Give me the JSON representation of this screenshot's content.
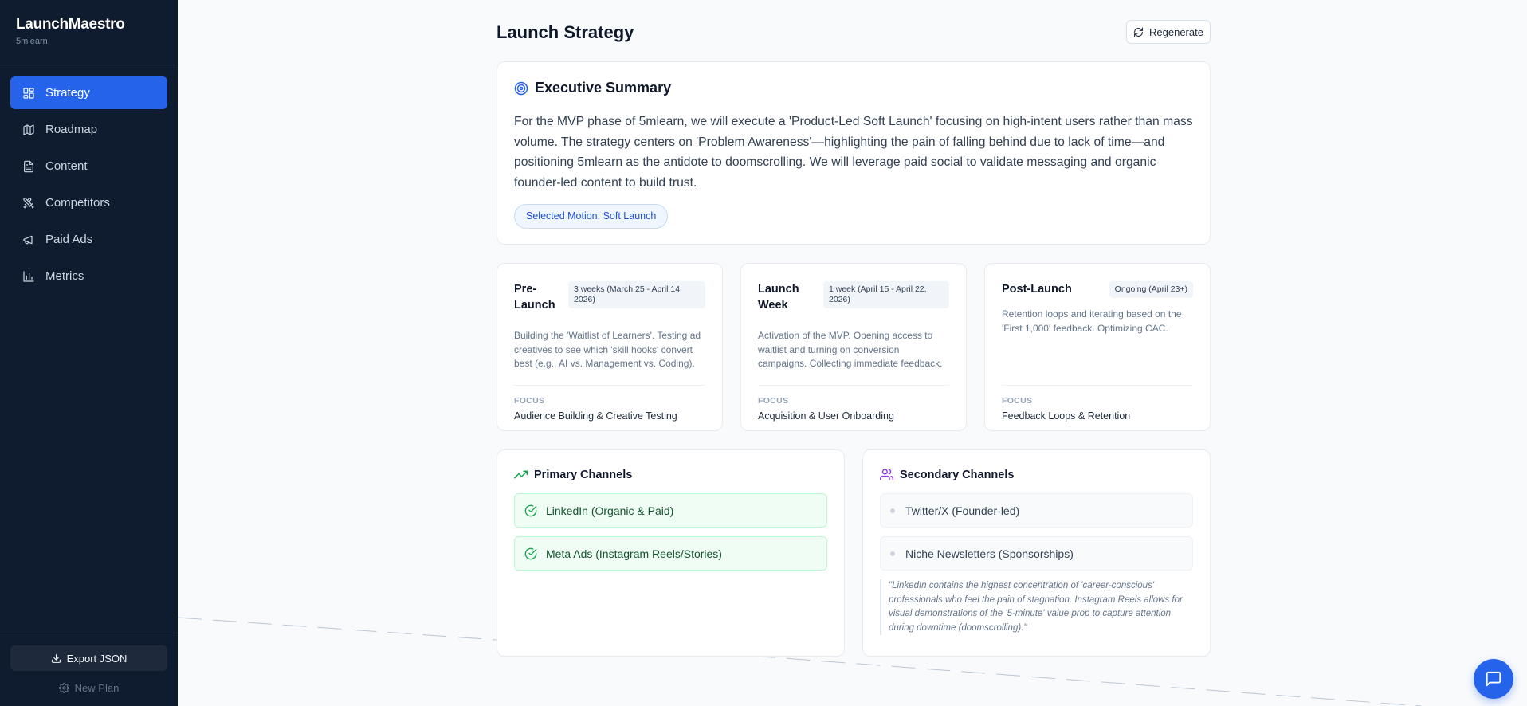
{
  "app": {
    "name": "LaunchMaestro",
    "project": "5mlearn"
  },
  "sidebar": {
    "items": [
      {
        "label": "Strategy",
        "icon": "grid-icon",
        "active": true
      },
      {
        "label": "Roadmap",
        "icon": "map-icon",
        "active": false
      },
      {
        "label": "Content",
        "icon": "file-text-icon",
        "active": false
      },
      {
        "label": "Competitors",
        "icon": "swords-icon",
        "active": false
      },
      {
        "label": "Paid Ads",
        "icon": "megaphone-icon",
        "active": false
      },
      {
        "label": "Metrics",
        "icon": "bar-chart-icon",
        "active": false
      }
    ],
    "export_label": "Export JSON",
    "new_plan_label": "New Plan"
  },
  "header": {
    "title": "Launch Strategy",
    "regenerate_label": "Regenerate"
  },
  "summary": {
    "title": "Executive Summary",
    "body": "For the MVP phase of 5mlearn, we will execute a 'Product-Led Soft Launch' focusing on high-intent users rather than mass volume. The strategy centers on 'Problem Awareness'—highlighting the pain of falling behind due to lack of time—and positioning 5mlearn as the antidote to doomscrolling. We will leverage paid social to validate messaging and organic founder-led content to build trust.",
    "motion_badge": "Selected Motion: Soft Launch"
  },
  "phases": [
    {
      "name": "Pre-Launch",
      "duration": "3 weeks (March 25 - April 14, 2026)",
      "description": "Building the 'Waitlist of Learners'. Testing ad creatives to see which 'skill hooks' convert best (e.g., AI vs. Management vs. Coding).",
      "focus_label": "FOCUS",
      "focus": "Audience Building & Creative Testing"
    },
    {
      "name": "Launch Week",
      "duration": "1 week (April 15 - April 22, 2026)",
      "description": "Activation of the MVP. Opening access to waitlist and turning on conversion campaigns. Collecting immediate feedback.",
      "focus_label": "FOCUS",
      "focus": "Acquisition & User Onboarding"
    },
    {
      "name": "Post-Launch",
      "duration": "Ongoing (April 23+)",
      "description": "Retention loops and iterating based on the 'First 1,000' feedback. Optimizing CAC.",
      "focus_label": "FOCUS",
      "focus": "Feedback Loops & Retention"
    }
  ],
  "primary_channels": {
    "title": "Primary Channels",
    "items": [
      "LinkedIn (Organic & Paid)",
      "Meta Ads (Instagram Reels/Stories)"
    ]
  },
  "secondary_channels": {
    "title": "Secondary Channels",
    "items": [
      "Twitter/X (Founder-led)",
      "Niche Newsletters (Sponsorships)"
    ],
    "rationale": "\"LinkedIn contains the highest concentration of 'career-conscious' professionals who feel the pain of stagnation. Instagram Reels allows for visual demonstrations of the '5-minute' value prop to capture attention during downtime (doomscrolling).\""
  },
  "colors": {
    "accent": "#2563eb",
    "sidebar_bg": "#0f1b2e",
    "success": "#16a34a",
    "secondary_icon": "#9333ea"
  }
}
